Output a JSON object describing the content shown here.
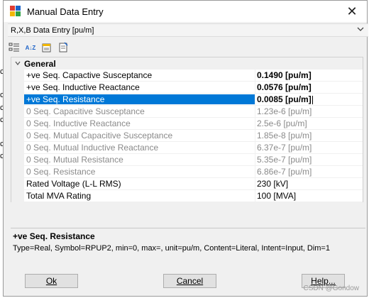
{
  "window": {
    "title": "Manual Data Entry",
    "close_glyph": "✕"
  },
  "combo": {
    "value": "R,X,B Data Entry [pu/m]"
  },
  "toolbar": {
    "icons": [
      "categorized-view-icon",
      "sort-alphabetical-icon",
      "property-pages-icon",
      "properties-icon"
    ],
    "sort_glyph": "A↓Z"
  },
  "grid": {
    "category": "General",
    "rows": [
      {
        "name": "+ve Seq. Capactive Susceptance",
        "value": "0.1490 [pu/m]"
      },
      {
        "name": "+ve Seq. Inductive Reactance",
        "value": "0.0576 [pu/m]"
      },
      {
        "name": "+ve Seq. Resistance",
        "value": "0.0085 [pu/m]"
      },
      {
        "name": "0 Seq. Capacitive Susceptance",
        "value": "1.23e-6 [pu/m]"
      },
      {
        "name": "0 Seq. Inductive Reactance",
        "value": "2.5e-6 [pu/m]"
      },
      {
        "name": "0 Seq. Mutual Capacitive Susceptance",
        "value": "1.85e-8 [pu/m]"
      },
      {
        "name": "0 Seq. Mutual Inductive Reactance",
        "value": "6.37e-7 [pu/m]"
      },
      {
        "name": "0 Seq. Mutual Resistance",
        "value": "5.35e-7 [pu/m]"
      },
      {
        "name": "0 Seq. Resistance",
        "value": "6.86e-7 [pu/m]"
      },
      {
        "name": "Rated Voltage (L-L RMS)",
        "value": "230 [kV]"
      },
      {
        "name": "Total MVA Rating",
        "value": "100 [MVA]"
      }
    ]
  },
  "description": {
    "title": "+ve Seq. Resistance",
    "body": "Type=Real, Symbol=RPUP2, min=0, max=, unit=pu/m, Content=Literal, Intent=Input, Dim=1"
  },
  "buttons": {
    "ok": "Ok",
    "cancel": "Cancel",
    "help": "Help..."
  },
  "watermark": "CSDN @Gondow",
  "left_strip_glyphs": [
    "c",
    "c",
    "c",
    "c",
    "c",
    "c"
  ],
  "colors": {
    "selection": "#0078d7",
    "dim_text": "#8a8a8a",
    "accent_icon_red": "#e03c31",
    "accent_icon_blue": "#1e64c8",
    "accent_icon_yellow": "#f2b705"
  }
}
